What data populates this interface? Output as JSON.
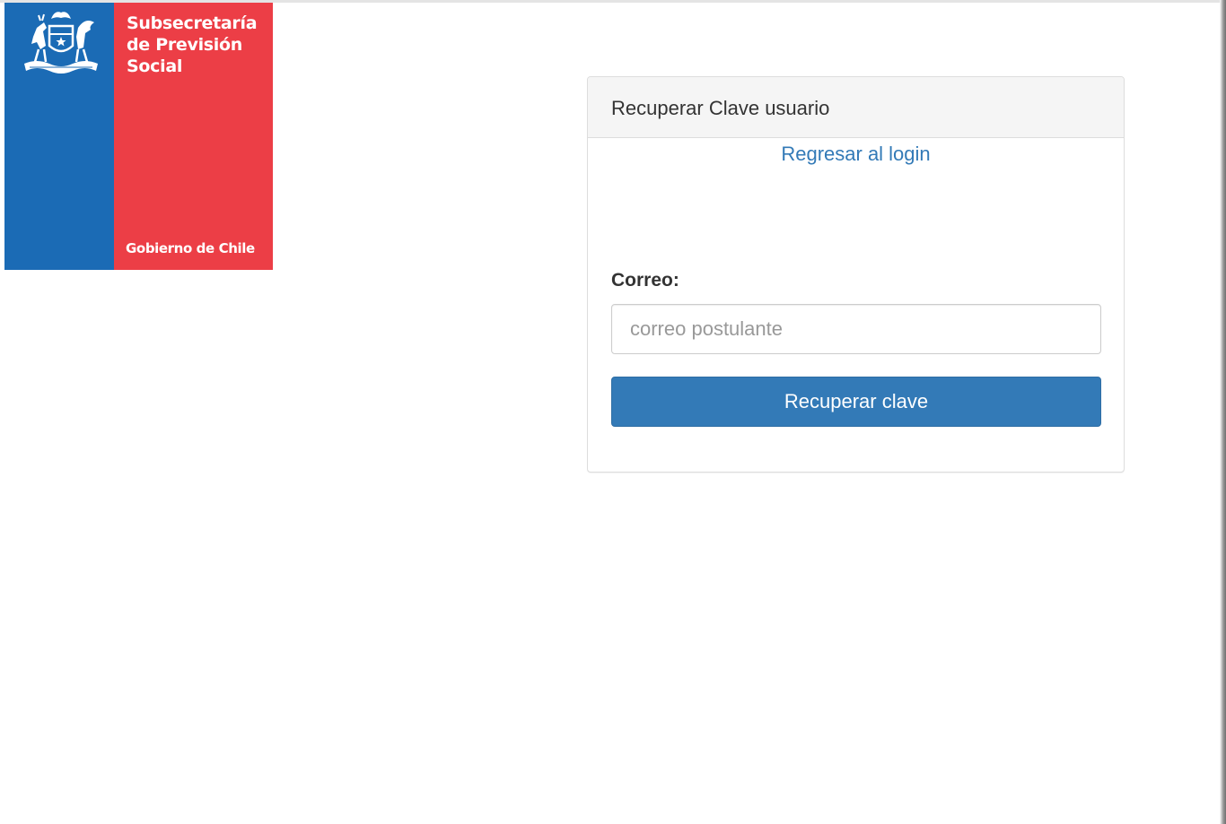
{
  "brand": {
    "title": "Subsecretaría\nde Previsión\nSocial",
    "footer": "Gobierno de Chile",
    "crest_icon": "chile-coat-of-arms-icon",
    "colors": {
      "blue": "#1b6bb5",
      "red": "#ec3e46"
    }
  },
  "panel": {
    "heading": "Recuperar Clave usuario",
    "back_link": "Regresar al login",
    "email_label": "Correo:",
    "email_placeholder": "correo postulante",
    "email_value": "",
    "submit_label": "Recuperar clave"
  },
  "colors": {
    "primary": "#337ab7",
    "link": "#337ab7",
    "heading_bg": "#f5f5f5"
  }
}
